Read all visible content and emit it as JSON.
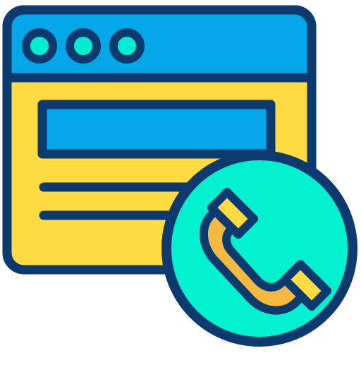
{
  "icon": {
    "subject": "web-call-icon",
    "parts": [
      "browser-window-icon",
      "telephone-handset-icon"
    ]
  },
  "colors": {
    "outline": "#0c3a6e",
    "title_bar": "#03a7e8",
    "window_body": "#fedb41",
    "window_dots": "#00edd2",
    "address_bar": "#03a7e8",
    "call_circle": "#00f0d0",
    "handset_body": "#f4ba3f",
    "handset_caps": "#fedb41",
    "background": "#ffffff"
  }
}
